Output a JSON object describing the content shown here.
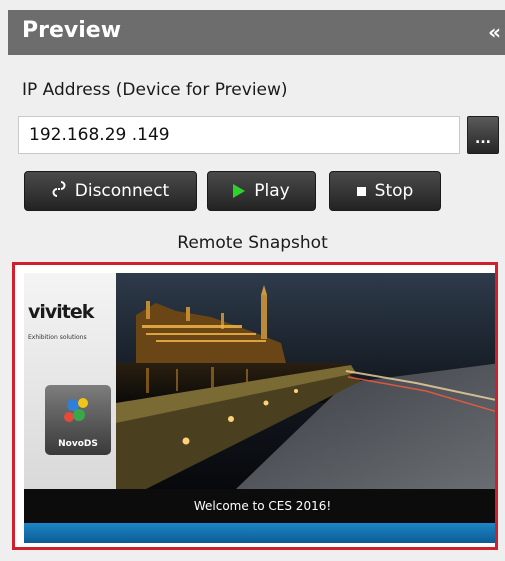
{
  "header": {
    "title": "Preview",
    "collapse_glyph": "«"
  },
  "ip": {
    "label": "IP Address (Device for Preview)",
    "value": "192.168.29 .149",
    "browse_glyph": "..."
  },
  "controls": {
    "disconnect_label": "Disconnect",
    "play_label": "Play",
    "stop_label": "Stop",
    "disconnect_icon": "link-broken-icon",
    "play_icon": "play-icon",
    "stop_icon": "stop-icon",
    "play_color": "#2fd12f"
  },
  "snapshot": {
    "label": "Remote Snapshot",
    "border_color": "#d21f2c",
    "logo_text": "vivitek",
    "logo_subtext": "Exhibition solutions",
    "badge_text": "NovoDS",
    "welcome_text": "Welcome to CES 2016!"
  }
}
